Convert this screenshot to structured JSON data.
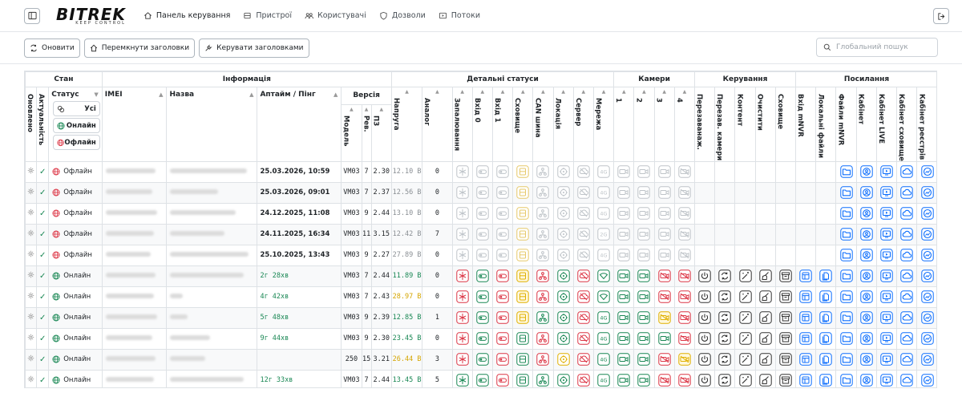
{
  "app": {
    "logo_main": "BITREK",
    "logo_sub": "KEEP CONTROL",
    "nav": [
      {
        "label": "Панель керування",
        "icon": "home-icon",
        "active": true
      },
      {
        "label": "Пристрої",
        "icon": "device-icon",
        "active": false
      },
      {
        "label": "Користувачі",
        "icon": "users-icon",
        "active": false
      },
      {
        "label": "Дозволи",
        "icon": "shield-icon",
        "active": false
      },
      {
        "label": "Потоки",
        "icon": "stream-icon",
        "active": false
      }
    ]
  },
  "toolbar": {
    "refresh_label": "Оновити",
    "toggle_headers_label": "Перемкнути заголовки",
    "manage_headers_label": "Керувати заголовками",
    "search_placeholder": "Глобальний пошук"
  },
  "table": {
    "groups": {
      "state": "Стан",
      "info": "Інформація",
      "detail": "Детальні статуси",
      "cameras": "Камери",
      "control": "Керування",
      "links": "Посилання"
    },
    "headers": {
      "updated": "Оновлено",
      "actual": "Актуальність",
      "status": "Статус",
      "imei": "IMEI",
      "name": "Назва",
      "uptime": "Аптайм / Пінг",
      "version": "Версія",
      "model": "Модель",
      "rev": "Рев.",
      "fw": "ПЗ",
      "voltage": "Напруга",
      "analog": "Аналог",
      "ignition": "Запалювання",
      "in0": "Вхід 0",
      "in1": "Вхід 1",
      "storage": "Сховище",
      "can": "CAN шина",
      "location": "Локація",
      "server": "Сервер",
      "network": "Мережа",
      "cam1": "1",
      "cam2": "2",
      "cam3": "3",
      "cam4": "4",
      "reboot": "Перезаванаж.",
      "reboot_cam": "Перезав. камери",
      "content": "Контент",
      "clean": "Очистити",
      "storage_ctl": "Сховище",
      "in_mnvr": "Вхід mNVR",
      "local_files": "Локальні файли",
      "mnvr_files": "Файли mNVR",
      "cabinet": "Кабінет",
      "cabinet_live": "Кабінет LIVE",
      "cabinet_storage": "Кабінет сховище",
      "cabinet_registry": "Кабінет реєстрів"
    },
    "status_filter": {
      "all": "Усі",
      "online": "Онлайн",
      "offline": "Офлайн"
    },
    "rows": [
      {
        "status": "Офлайн",
        "online": false,
        "uptime": "25.03.2026, 10:59",
        "model": "VM03",
        "rev": "7",
        "fw": "2.30",
        "voltage": "12.10 В",
        "vcolor": "grey",
        "analog": "0",
        "net": "4G"
      },
      {
        "status": "Офлайн",
        "online": false,
        "uptime": "25.03.2026, 09:01",
        "model": "VM03",
        "rev": "7",
        "fw": "2.37",
        "voltage": "12.56 В",
        "vcolor": "grey",
        "analog": "0",
        "net": "4G"
      },
      {
        "status": "Офлайн",
        "online": false,
        "uptime": "24.12.2025, 11:08",
        "model": "VM03",
        "rev": "9",
        "fw": "2.44",
        "voltage": "13.10 В",
        "vcolor": "grey",
        "analog": "0",
        "net": "4G"
      },
      {
        "status": "Офлайн",
        "online": false,
        "uptime": "24.11.2025, 16:34",
        "model": "VM03",
        "rev": "11",
        "fw": "3.15",
        "voltage": "12.42 В",
        "vcolor": "grey",
        "analog": "7",
        "net": "2G"
      },
      {
        "status": "Офлайн",
        "online": false,
        "uptime": "25.10.2025, 13:43",
        "model": "VM03",
        "rev": "9",
        "fw": "2.27",
        "voltage": "27.89 В",
        "vcolor": "grey",
        "analog": "0",
        "net": "4G"
      },
      {
        "status": "Онлайн",
        "online": true,
        "uptime": "2г 28хв",
        "model": "VM03",
        "rev": "7",
        "fw": "2.44",
        "voltage": "11.89 В",
        "vcolor": "green",
        "analog": "0",
        "net": "wifi"
      },
      {
        "status": "Онлайн",
        "online": true,
        "uptime": "4г 42хв",
        "model": "VM03",
        "rev": "7",
        "fw": "2.43",
        "voltage": "28.97 В",
        "vcolor": "yellow",
        "analog": "0",
        "net": "wifi"
      },
      {
        "status": "Онлайн",
        "online": true,
        "uptime": "5г 48хв",
        "model": "VM03",
        "rev": "9",
        "fw": "2.39",
        "voltage": "12.85 В",
        "vcolor": "green",
        "analog": "1",
        "net": "4G"
      },
      {
        "status": "Онлайн",
        "online": true,
        "uptime": "9г 44хв",
        "model": "VM03",
        "rev": "9",
        "fw": "2.30",
        "voltage": "23.45 В",
        "vcolor": "green",
        "analog": "0",
        "net": "4G"
      },
      {
        "status": "Онлайн",
        "online": true,
        "uptime": "",
        "model": "250",
        "rev": "15",
        "fw": "3.21",
        "voltage": "26.44 В",
        "vcolor": "yellow",
        "analog": "3",
        "net": "4G"
      },
      {
        "status": "Онлайн",
        "online": true,
        "uptime": "12г 33хв",
        "model": "VM03",
        "rev": "7",
        "fw": "2.44",
        "voltage": "13.45 В",
        "vcolor": "green",
        "analog": "5",
        "net": "4G"
      }
    ]
  },
  "colors": {
    "online": "#198754",
    "offline": "#dc3545",
    "warning": "#e0b000",
    "link": "#0d6efd",
    "muted": "#bfc4c9"
  }
}
